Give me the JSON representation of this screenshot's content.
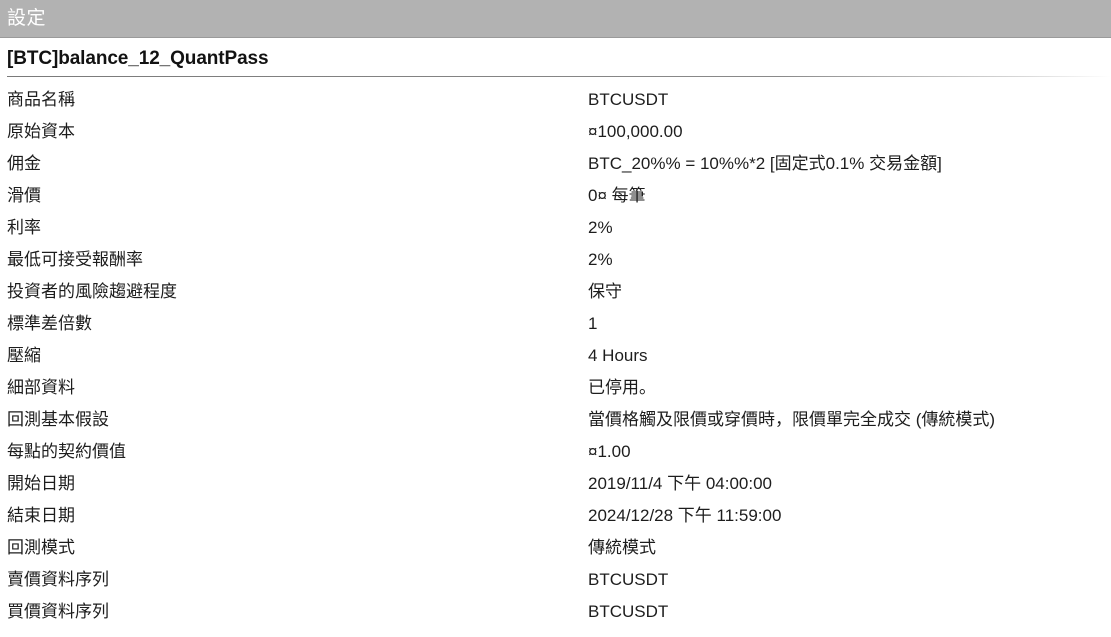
{
  "header": {
    "title": "設定"
  },
  "report": {
    "title": "[BTC]balance_12_QuantPass"
  },
  "colors": {
    "header_background": "#b2b2b2",
    "header_text": "#ffffff",
    "body_background": "#ffffff",
    "body_text": "#1d1d1d",
    "rule": "#7a7a7a"
  },
  "settings": {
    "rows": [
      {
        "label": "商品名稱",
        "value": "BTCUSDT"
      },
      {
        "label": "原始資本",
        "value": "¤100,000.00"
      },
      {
        "label": "佣金",
        "value": "BTC_20%% = 10%%*2 [固定式0.1% 交易金額]"
      },
      {
        "label": "滑價",
        "value": "0¤ 每筆"
      },
      {
        "label": "利率",
        "value": "2%"
      },
      {
        "label": "最低可接受報酬率",
        "value": "2%"
      },
      {
        "label": "投資者的風險趨避程度",
        "value": "保守"
      },
      {
        "label": "標準差倍數",
        "value": "1"
      },
      {
        "label": "壓縮",
        "value": "4 Hours"
      },
      {
        "label": "細部資料",
        "value": "已停用。"
      },
      {
        "label": "回測基本假設",
        "value": "當價格觸及限價或穿價時，限價單完全成交 (傳統模式)"
      },
      {
        "label": "每點的契約價值",
        "value": "¤1.00"
      },
      {
        "label": "開始日期",
        "value": "2019/11/4 下午 04:00:00"
      },
      {
        "label": "結束日期",
        "value": "2024/12/28 下午 11:59:00"
      },
      {
        "label": "回測模式",
        "value": "傳統模式"
      },
      {
        "label": "賣價資料序列",
        "value": "BTCUSDT"
      },
      {
        "label": "買價資料序列",
        "value": "BTCUSDT"
      }
    ]
  }
}
